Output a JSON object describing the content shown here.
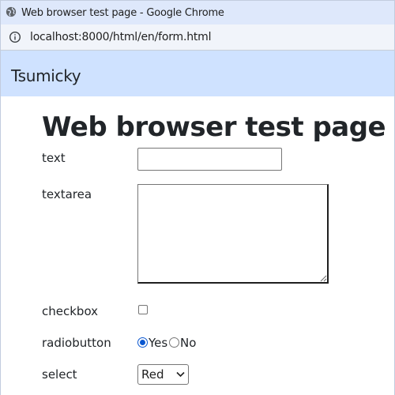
{
  "window": {
    "title": "Web browser test page - Google Chrome"
  },
  "addressbar": {
    "url": "localhost:8000/html/en/form.html",
    "info_icon": "info-icon"
  },
  "navbar": {
    "brand": "Tsumicky",
    "background": "#cfe2ff"
  },
  "page": {
    "title": "Web browser test page",
    "form": {
      "text_label": "text",
      "text_value": "",
      "textarea_label": "textarea",
      "textarea_value": "",
      "checkbox_label": "checkbox",
      "checkbox_checked": false,
      "radio_label": "radiobutton",
      "radio_options": [
        {
          "label": "Yes",
          "checked": true
        },
        {
          "label": "No",
          "checked": false
        }
      ],
      "select_label": "select",
      "select_value": "Red"
    }
  },
  "colors": {
    "accent": "#0b57d0",
    "titlebar": "#dee8fb",
    "text": "#212529"
  }
}
